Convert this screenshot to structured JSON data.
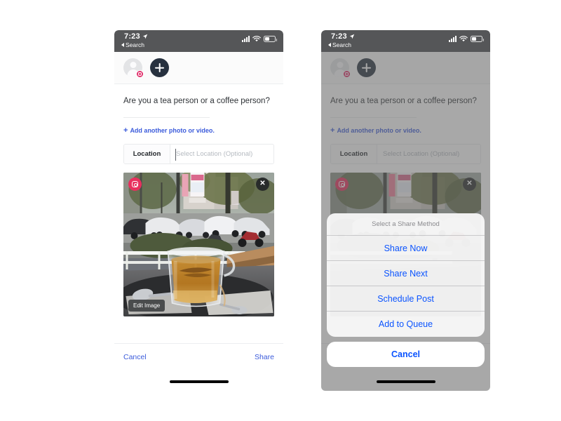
{
  "status_bar": {
    "time": "7:23",
    "back_label": "Search",
    "location_icon": "location-arrow-icon",
    "signal_icon": "cellular-bars-icon",
    "wifi_icon": "wifi-icon",
    "battery_icon": "battery-icon"
  },
  "account_bar": {
    "avatar_name": "instagram-account-avatar",
    "badge_icon": "instagram-badge-icon",
    "add_account_icon": "plus-icon"
  },
  "composer": {
    "post_text": "Are you a tea person or a coffee person?",
    "add_media_label": "Add another photo or video.",
    "add_media_plus": "+",
    "location_label": "Location",
    "location_placeholder": "Select Location (Optional)",
    "location_value": ""
  },
  "photo": {
    "alt": "Glass cup of tea on a cafe table by a window with a street view",
    "source_icon": "instagram-icon",
    "remove_icon": "close-icon",
    "edit_label": "Edit Image"
  },
  "footer": {
    "cancel_label": "Cancel",
    "share_label": "Share"
  },
  "action_sheet": {
    "title": "Select a Share Method",
    "options": [
      {
        "label": "Share Now"
      },
      {
        "label": "Share Next"
      },
      {
        "label": "Schedule Post"
      },
      {
        "label": "Add to Queue"
      }
    ],
    "cancel_label": "Cancel"
  },
  "colors": {
    "status_bar_bg": "#555658",
    "accent_blue": "#3b5bdb",
    "sheet_blue": "#0a53ff",
    "instagram_pink": "#e1306c",
    "plus_button_navy": "#27313f",
    "page_bg": "#ffffff"
  }
}
